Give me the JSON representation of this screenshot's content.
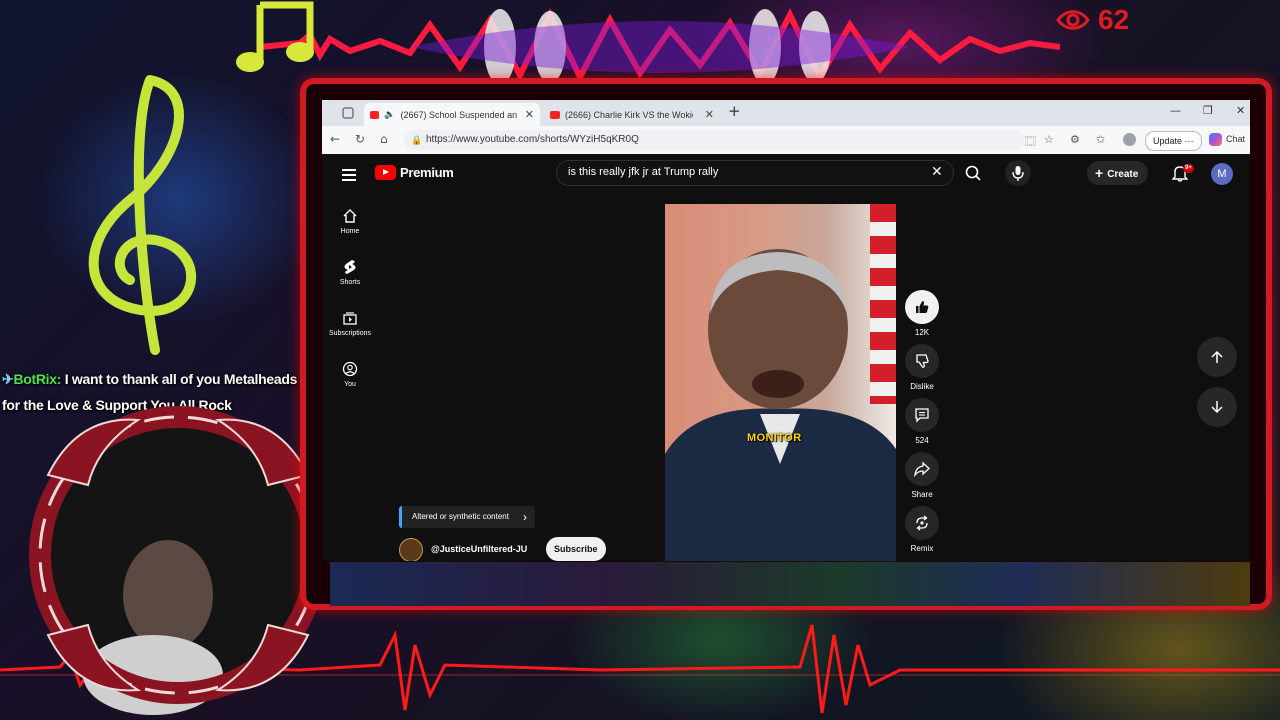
{
  "overlay": {
    "viewer_count": "62",
    "chat": {
      "user": "BotRix:",
      "message": "I want to thank all of you Metalheads for the Love & Support You All Rock"
    }
  },
  "browser": {
    "tabs": [
      {
        "title": "(2667) School Suspended an",
        "active": true
      },
      {
        "title": "(2666) Charlie Kirk VS the Wokies",
        "active": false
      }
    ],
    "url": "https://www.youtube.com/shorts/WYziH5qKR0Q",
    "update_label": "Update",
    "chat_label": "Chat"
  },
  "youtube": {
    "brand": "Premium",
    "search_query": "is this really jfk jr at Trump rally",
    "create_label": "Create",
    "notifications_badge": "9+",
    "avatar_letter": "M",
    "sidebar": [
      {
        "label": "Home"
      },
      {
        "label": "Shorts"
      },
      {
        "label": "Subscriptions"
      },
      {
        "label": "You"
      }
    ],
    "video": {
      "caption": "MONITOR"
    },
    "actions": {
      "like_count": "12K",
      "dislike_label": "Dislike",
      "comment_count": "524",
      "share_label": "Share",
      "remix_label": "Remix"
    },
    "synthetic_label": "Altered or synthetic content",
    "channel_name": "@JusticeUnfiltered-JU",
    "subscribe_label": "Subscribe"
  },
  "colors": {
    "accent": "#ff0000",
    "frame": "#d11a22",
    "caption": "#ffd400"
  }
}
